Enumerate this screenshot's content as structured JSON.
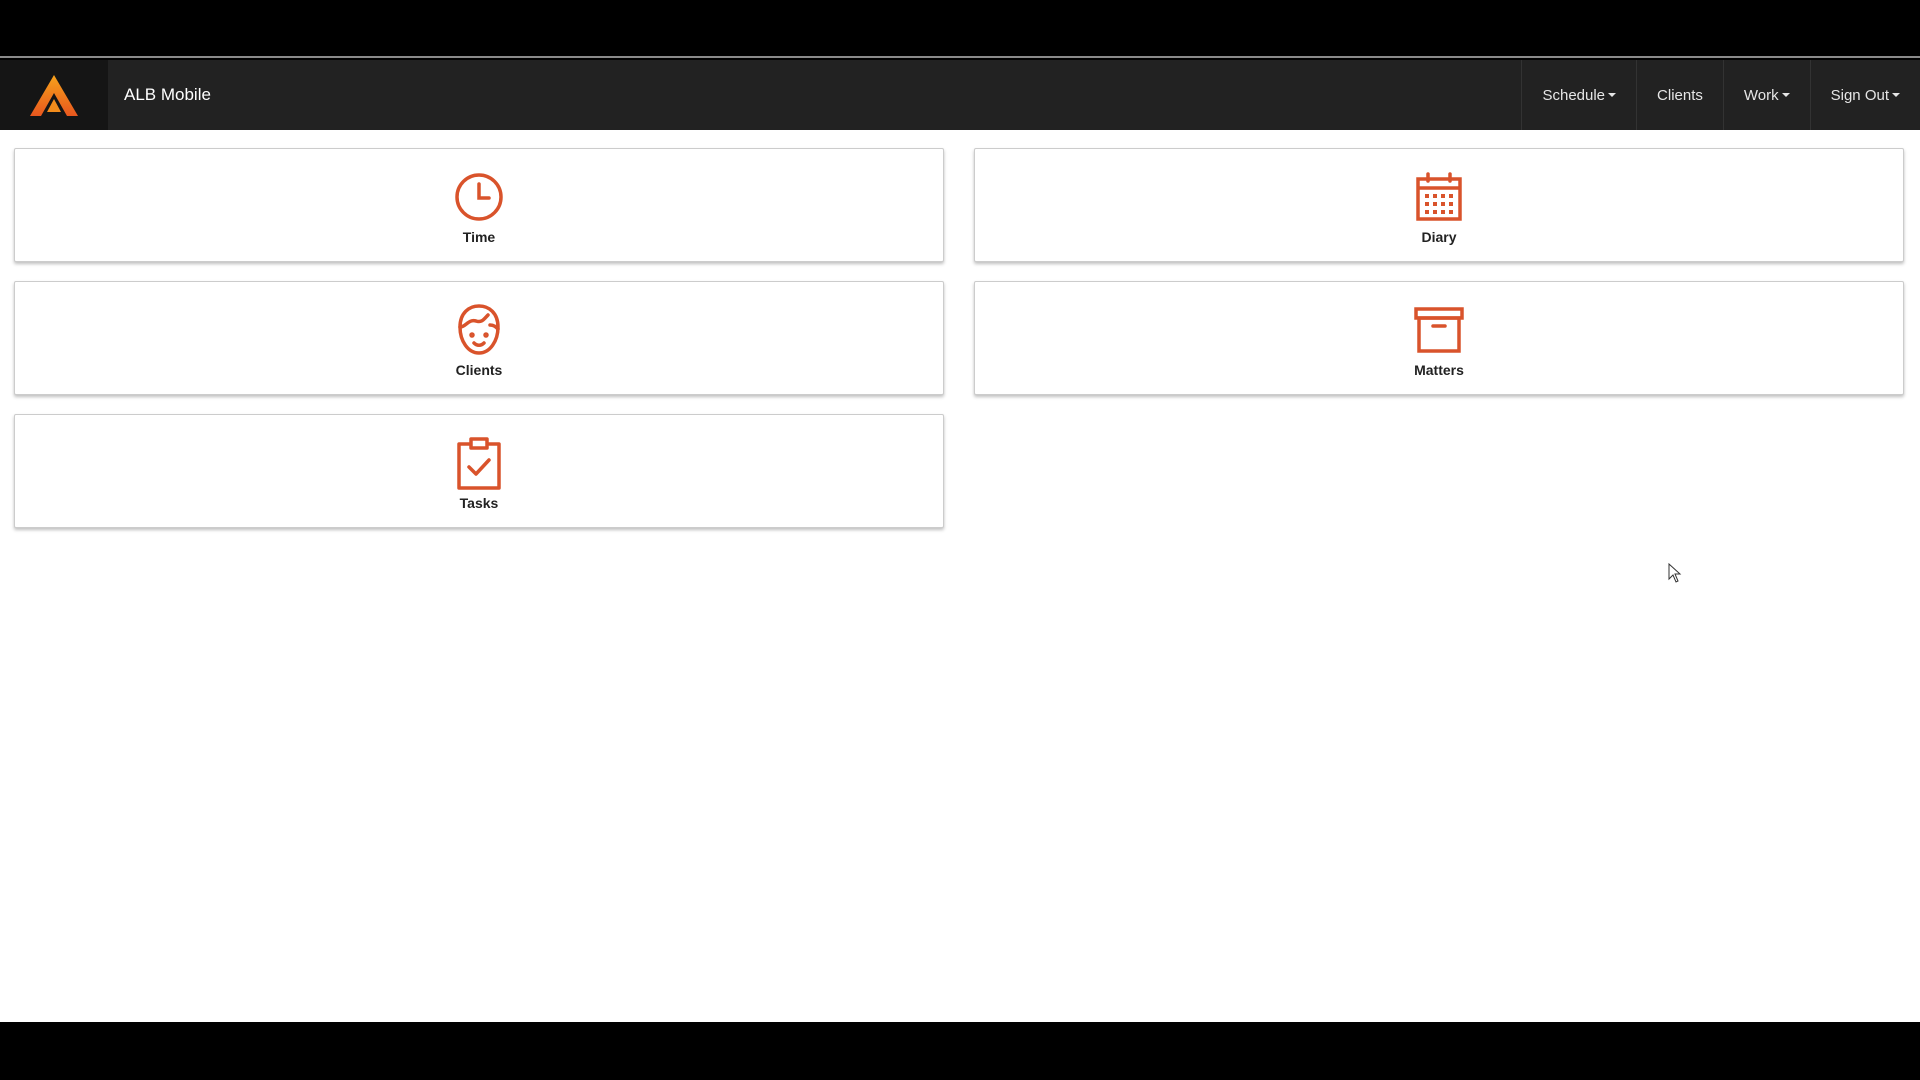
{
  "app": {
    "title": "ALB Mobile",
    "accent_color": "#d9532b",
    "navbar_color": "#222222"
  },
  "nav": {
    "items": [
      {
        "label": "Schedule",
        "dropdown": true
      },
      {
        "label": "Clients",
        "dropdown": false
      },
      {
        "label": "Work",
        "dropdown": true
      },
      {
        "label": "Sign Out",
        "dropdown": true
      }
    ]
  },
  "tiles": [
    {
      "label": "Time",
      "icon": "clock-icon"
    },
    {
      "label": "Diary",
      "icon": "calendar-icon"
    },
    {
      "label": "Clients",
      "icon": "person-face-icon"
    },
    {
      "label": "Matters",
      "icon": "archive-box-icon"
    },
    {
      "label": "Tasks",
      "icon": "clipboard-check-icon"
    }
  ]
}
